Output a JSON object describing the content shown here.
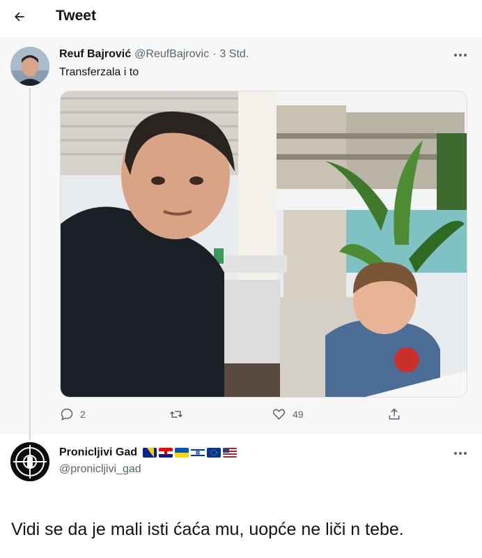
{
  "header": {
    "title": "Tweet",
    "back_icon": "arrow-left-icon"
  },
  "tweet": {
    "author_name": "Reuf Bajrović",
    "author_handle": "@ReufBajrovic",
    "separator": "·",
    "time": "3 Std.",
    "text": "Transferzala i to",
    "more_icon": "more-dots-icon",
    "photo": "photo of a man and a child at a cafe terrace by the sea",
    "actions": {
      "reply_count": "2",
      "retweet_count": "",
      "like_count": "49",
      "share_label": ""
    }
  },
  "reply": {
    "author_name": "Pronicljivi Gad",
    "author_handle": "@pronicljivi_gad",
    "flags": [
      "bosnia-flag-icon",
      "croatia-flag-icon",
      "ukraine-flag-icon",
      "israel-flag-icon",
      "eu-flag-icon",
      "usa-flag-icon"
    ],
    "text": "Vidi se da je mali isti ćaća mu, uopće ne liči n tebe."
  },
  "colors": {
    "text": "#0f1419",
    "secondary": "#536471",
    "background": "#ffffff",
    "quoted_bg": "#f7f7f7"
  }
}
